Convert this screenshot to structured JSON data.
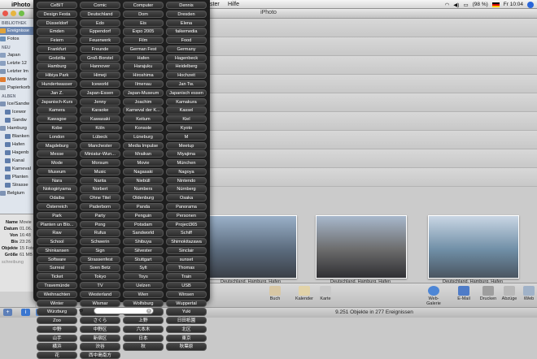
{
  "menubar": {
    "app": "iPhoto",
    "items": [
      "Fenster",
      "Hilfe"
    ],
    "battery": "(98 %)",
    "clock": "Fr 10:04"
  },
  "window": {
    "title": "iPhoto"
  },
  "sidebar": {
    "headers": [
      "BIBLIOTHEK",
      "NEU",
      "ALBEN"
    ],
    "library": [
      "Ereignisse",
      "Fotos"
    ],
    "recent": [
      "Japan",
      "Letzte 12",
      "Letzter Im",
      "Markierte",
      "Papierkorb"
    ],
    "albums": [
      "Ice/Sandw",
      "Icewor",
      "Sandw",
      "Hamburg",
      "Blanken",
      "Hafen",
      "Hagenb",
      "Kanal",
      "Karneval",
      "Planten",
      "Strasse",
      "Belgium"
    ]
  },
  "info": {
    "rows": [
      {
        "label": "Name",
        "value": "Movie"
      },
      {
        "label": "Datum",
        "value": "01.06."
      },
      {
        "label": "Von",
        "value": "16:48"
      },
      {
        "label": "Bis",
        "value": "23:26"
      },
      {
        "label": "Objekte",
        "value": "15 Foto"
      },
      {
        "label": "Größe",
        "value": "61 MB"
      }
    ],
    "description": "schreibung"
  },
  "keywords": [
    "CeBIT",
    "Comic",
    "Computer",
    "Dennis",
    "Design Festa",
    "Deutschland",
    "Dom",
    "Dresden",
    "Düsseldorf",
    "Edo",
    "Eis",
    "Elena",
    "Emden",
    "Eppendorf",
    "Expo 2005",
    "faikemedia",
    "Feiern",
    "Feuerwerk",
    "Film",
    "Food",
    "Frankfurt",
    "Freunde",
    "German Fest",
    "Germany",
    "Godzilla",
    "Groß-Borstel",
    "Hafen",
    "Hagenbeck",
    "Hamburg",
    "Hannover",
    "Harajuku",
    "Heidelberg",
    "Hibiya Park",
    "Himeji",
    "Hiroshima",
    "Hochzeit",
    "Hundertwasser",
    "Iceworld",
    "Ilmenau",
    "Jan Tw.",
    "Jan Z.",
    "Japan-Essen",
    "Japan-Museum",
    "Japanisch essen",
    "Japanisch-Kurs",
    "Jenny",
    "Joachim",
    "Kamakura",
    "Kamera",
    "Karaoke",
    "Karneval der K...",
    "Kassel",
    "Kawagoe",
    "Kawasaki",
    "Keitum",
    "Kiel",
    "Kobe",
    "Köln",
    "Konsole",
    "Kyoto",
    "London",
    "Lübeck",
    "Lüneburg",
    "M",
    "Magdeburg",
    "Manchester",
    "Media Impulse",
    "Meetup",
    "Messe",
    "Miniatur-Wun...",
    "Mraikan",
    "Miyajima",
    "Mode",
    "Morsum",
    "Movie",
    "München",
    "Museum",
    "Music",
    "Nagasaki",
    "Nagoya",
    "Nara",
    "Narita",
    "Niebüll",
    "Nintendo",
    "Nokogiriyama",
    "Norbert",
    "Numbers",
    "Nürnberg",
    "Odaiba",
    "Ohne Titel",
    "Oldenburg",
    "Osaka",
    "Österreich",
    "Paderborn",
    "Panda",
    "Panorama",
    "Park",
    "Party",
    "Penguin",
    "Personen",
    "Planten un Blo...",
    "Pong",
    "Potsdam",
    "Project365",
    "Raw",
    "Rufus",
    "Sandworld",
    "Schiff",
    "School",
    "Schwerin",
    "Shibuya",
    "Shimokitazawa",
    "Shinkansen",
    "Sign",
    "Silvester",
    "Sinclair",
    "Software",
    "Strassenfest",
    "Stuttgart",
    "sunset",
    "Surreal",
    "Sven Betz",
    "Sylt",
    "Thomas",
    "Ticket",
    "Tokyo",
    "Toys",
    "Train",
    "Travemünde",
    "TV",
    "Uelzen",
    "USB",
    "Weihnachten",
    "Westerland",
    "Wien",
    "Winsen",
    "Winter",
    "Wismar",
    "Wolfsburg",
    "Wuppertal",
    "Würzburg",
    "Yoko",
    "Yokosuka",
    "Yuki",
    "Zoo",
    "さくら",
    "上野",
    "日田祇園",
    "中野",
    "中野区",
    "六本木",
    "北区",
    "山手",
    "新宿区",
    "日本",
    "東京",
    "横浜",
    "渋谷",
    "秋",
    "秋葉原",
    "花",
    "西中島南方"
  ],
  "photos": [
    {
      "caption": "Deutschland, Hamburg, Hafen",
      "colors": [
        "#9ab0c8",
        "#5b6b7d",
        "#3a3f47"
      ]
    },
    {
      "caption": "Deutschland, Hamburg, Hafen",
      "colors": [
        "#a8b8cc",
        "#6b6b6b",
        "#2f2f33"
      ]
    },
    {
      "caption": "Deutschland, Hamburg, Hafen",
      "colors": [
        "#c9d6e4",
        "#6f8ea6",
        "#4a5560"
      ]
    }
  ],
  "toolbar": {
    "left": [
      "Buch",
      "Kalender",
      "Karte"
    ],
    "right": [
      "Web-Galerie",
      "E-Mail",
      "Drucken",
      "Abzüge",
      "iWeb"
    ]
  },
  "statusbar": {
    "text": "9.251 Objekte in 277 Ereignissen"
  },
  "keyword_toggle": "⊕"
}
